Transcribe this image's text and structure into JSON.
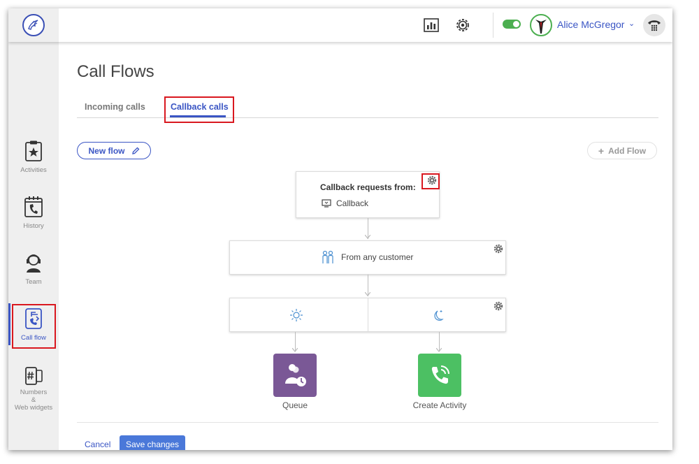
{
  "topbar": {
    "user_name": "Alice McGregor",
    "user_caret": "⌄",
    "status_toggle_on": true,
    "accent_color": "#3a55c4",
    "status_color": "#4caf50"
  },
  "sidebar": {
    "items": [
      {
        "label": "Activities",
        "icon": "clipboard-star-icon"
      },
      {
        "label": "History",
        "icon": "calendar-phone-icon"
      },
      {
        "label": "Team",
        "icon": "agent-headset-icon"
      },
      {
        "label": "Call flow",
        "icon": "call-flow-icon"
      },
      {
        "label_lines": [
          "Numbers",
          "&",
          "Web widgets"
        ],
        "icon": "hash-phone-icon"
      }
    ],
    "active": "Call flow"
  },
  "page": {
    "title": "Call Flows",
    "tabs": [
      {
        "label": "Incoming calls"
      },
      {
        "label": "Callback calls"
      }
    ],
    "active_tab": "Callback calls",
    "new_flow_label": "New flow",
    "add_flow_label": "Add Flow"
  },
  "flow": {
    "source": {
      "title": "Callback requests from:",
      "item": "Callback"
    },
    "filter": {
      "label": "From any customer"
    },
    "schedule": {
      "open_icon": "sun-icon",
      "closed_icon": "moon-icon"
    },
    "targets": [
      {
        "label": "Queue",
        "color": "#7a5896",
        "icon": "queue-icon"
      },
      {
        "label": "Create Activity",
        "color": "#4cc063",
        "icon": "phone-icon"
      }
    ]
  },
  "footer": {
    "cancel_label": "Cancel",
    "save_label": "Save changes"
  }
}
